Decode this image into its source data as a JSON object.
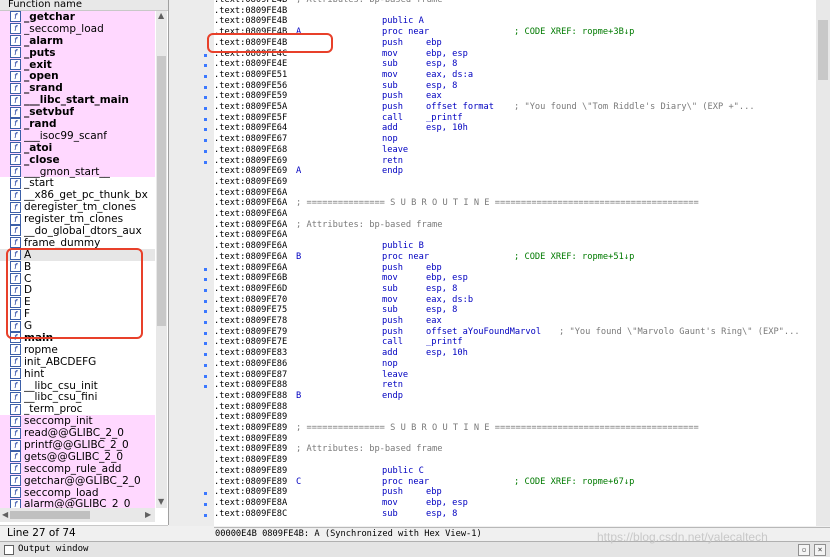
{
  "functions_panel": {
    "header": "Function name",
    "items": [
      {
        "label": "_getchar",
        "lib": true,
        "bold": true
      },
      {
        "label": "_seccomp_load",
        "lib": true,
        "bold": false
      },
      {
        "label": "_alarm",
        "lib": true,
        "bold": true
      },
      {
        "label": "_puts",
        "lib": true,
        "bold": true
      },
      {
        "label": "_exit",
        "lib": true,
        "bold": true
      },
      {
        "label": "_open",
        "lib": true,
        "bold": true
      },
      {
        "label": "_srand",
        "lib": true,
        "bold": true
      },
      {
        "label": "___libc_start_main",
        "lib": true,
        "bold": true
      },
      {
        "label": "_setvbuf",
        "lib": true,
        "bold": true
      },
      {
        "label": "_rand",
        "lib": true,
        "bold": true
      },
      {
        "label": "___isoc99_scanf",
        "lib": true,
        "bold": false
      },
      {
        "label": "_atoi",
        "lib": true,
        "bold": true
      },
      {
        "label": "_close",
        "lib": true,
        "bold": true
      },
      {
        "label": "___gmon_start__",
        "lib": true,
        "bold": false
      },
      {
        "label": "_start",
        "lib": false,
        "bold": false
      },
      {
        "label": "__x86_get_pc_thunk_bx",
        "lib": false,
        "bold": false
      },
      {
        "label": "deregister_tm_clones",
        "lib": false,
        "bold": false
      },
      {
        "label": "register_tm_clones",
        "lib": false,
        "bold": false
      },
      {
        "label": "__do_global_dtors_aux",
        "lib": false,
        "bold": false
      },
      {
        "label": "frame_dummy",
        "lib": false,
        "bold": false
      },
      {
        "label": "A",
        "lib": false,
        "bold": false,
        "selected": true
      },
      {
        "label": "B",
        "lib": false,
        "bold": false
      },
      {
        "label": "C",
        "lib": false,
        "bold": false
      },
      {
        "label": "D",
        "lib": false,
        "bold": false
      },
      {
        "label": "E",
        "lib": false,
        "bold": false
      },
      {
        "label": "F",
        "lib": false,
        "bold": false
      },
      {
        "label": "G",
        "lib": false,
        "bold": false
      },
      {
        "label": "main",
        "lib": false,
        "bold": true
      },
      {
        "label": "ropme",
        "lib": false,
        "bold": false
      },
      {
        "label": "init_ABCDEFG",
        "lib": false,
        "bold": false
      },
      {
        "label": "hint",
        "lib": false,
        "bold": false
      },
      {
        "label": "__libc_csu_init",
        "lib": false,
        "bold": false
      },
      {
        "label": "__libc_csu_fini",
        "lib": false,
        "bold": false
      },
      {
        "label": "_term_proc",
        "lib": false,
        "bold": false
      },
      {
        "label": "seccomp_init",
        "lib": true,
        "bold": false
      },
      {
        "label": "read@@GLIBC_2_0",
        "lib": true,
        "bold": false
      },
      {
        "label": "printf@@GLIBC_2_0",
        "lib": true,
        "bold": false
      },
      {
        "label": "gets@@GLIBC_2_0",
        "lib": true,
        "bold": false
      },
      {
        "label": "seccomp_rule_add",
        "lib": true,
        "bold": false
      },
      {
        "label": "getchar@@GLIBC_2_0",
        "lib": true,
        "bold": false
      },
      {
        "label": "seccomp_load",
        "lib": true,
        "bold": false
      },
      {
        "label": "alarm@@GLIBC_2_0",
        "lib": true,
        "bold": false
      }
    ],
    "status": "Line 27 of 74",
    "icon_glyph": "f"
  },
  "disassembly": {
    "lines": [
      {
        "addr": ".text:0809FE4B",
        "cm": "; Attributes: bp-based frame",
        "cmx": 82
      },
      {
        "addr": ".text:0809FE4B"
      },
      {
        "addr": ".text:0809FE4B",
        "mn": "public A"
      },
      {
        "addr": ".text:0809FE4B",
        "lbl": "A",
        "mn": "proc near",
        "xref": "; CODE XREF: ropme+3B↓p"
      },
      {
        "addr": ".text:0809FE4B",
        "mn": "push",
        "op": "ebp"
      },
      {
        "addr": ".text:0809FE4C",
        "mn": "mov",
        "op": "ebp, esp",
        "dot": true
      },
      {
        "addr": ".text:0809FE4E",
        "mn": "sub",
        "op": "esp, 8",
        "dot": true
      },
      {
        "addr": ".text:0809FE51",
        "mn": "mov",
        "op": "eax, ds:a",
        "dot": true
      },
      {
        "addr": ".text:0809FE56",
        "mn": "sub",
        "op": "esp, 8",
        "dot": true
      },
      {
        "addr": ".text:0809FE59",
        "mn": "push",
        "op": "eax",
        "dot": true
      },
      {
        "addr": ".text:0809FE5A",
        "mn": "push",
        "op": "offset format",
        "cm": "; \"You found \\\"Tom Riddle's Diary\\\" (EXP +\"...",
        "cmx": 300,
        "dot": true
      },
      {
        "addr": ".text:0809FE5F",
        "mn": "call",
        "op": "_printf",
        "dot": true
      },
      {
        "addr": ".text:0809FE64",
        "mn": "add",
        "op": "esp, 10h",
        "dot": true
      },
      {
        "addr": ".text:0809FE67",
        "mn": "nop",
        "dot": true
      },
      {
        "addr": ".text:0809FE68",
        "mn": "leave",
        "dot": true
      },
      {
        "addr": ".text:0809FE69",
        "mn": "retn",
        "dot": true
      },
      {
        "addr": ".text:0809FE69",
        "lbl": "A",
        "mn": "endp"
      },
      {
        "addr": ".text:0809FE69"
      },
      {
        "addr": ".text:0809FE6A"
      },
      {
        "addr": ".text:0809FE6A",
        "cm": "; =============== S U B R O U T I N E =======================================",
        "cmx": 82
      },
      {
        "addr": ".text:0809FE6A"
      },
      {
        "addr": ".text:0809FE6A",
        "cm": "; Attributes: bp-based frame",
        "cmx": 82
      },
      {
        "addr": ".text:0809FE6A"
      },
      {
        "addr": ".text:0809FE6A",
        "mn": "public B"
      },
      {
        "addr": ".text:0809FE6A",
        "lbl": "B",
        "mn": "proc near",
        "xref": "; CODE XREF: ropme+51↓p"
      },
      {
        "addr": ".text:0809FE6A",
        "mn": "push",
        "op": "ebp",
        "dot": true
      },
      {
        "addr": ".text:0809FE6B",
        "mn": "mov",
        "op": "ebp, esp",
        "dot": true
      },
      {
        "addr": ".text:0809FE6D",
        "mn": "sub",
        "op": "esp, 8",
        "dot": true
      },
      {
        "addr": ".text:0809FE70",
        "mn": "mov",
        "op": "eax, ds:b",
        "dot": true
      },
      {
        "addr": ".text:0809FE75",
        "mn": "sub",
        "op": "esp, 8",
        "dot": true
      },
      {
        "addr": ".text:0809FE78",
        "mn": "push",
        "op": "eax",
        "dot": true
      },
      {
        "addr": ".text:0809FE79",
        "mn": "push",
        "op": "offset aYouFoundMarvol",
        "cm": "; \"You found \\\"Marvolo Gaunt's Ring\\\" (EXP\"...",
        "cmx": 345,
        "dot": true
      },
      {
        "addr": ".text:0809FE7E",
        "mn": "call",
        "op": "_printf",
        "dot": true
      },
      {
        "addr": ".text:0809FE83",
        "mn": "add",
        "op": "esp, 10h",
        "dot": true
      },
      {
        "addr": ".text:0809FE86",
        "mn": "nop",
        "dot": true
      },
      {
        "addr": ".text:0809FE87",
        "mn": "leave",
        "dot": true
      },
      {
        "addr": ".text:0809FE88",
        "mn": "retn",
        "dot": true
      },
      {
        "addr": ".text:0809FE88",
        "lbl": "B",
        "mn": "endp"
      },
      {
        "addr": ".text:0809FE88"
      },
      {
        "addr": ".text:0809FE89"
      },
      {
        "addr": ".text:0809FE89",
        "cm": "; =============== S U B R O U T I N E =======================================",
        "cmx": 82
      },
      {
        "addr": ".text:0809FE89"
      },
      {
        "addr": ".text:0809FE89",
        "cm": "; Attributes: bp-based frame",
        "cmx": 82
      },
      {
        "addr": ".text:0809FE89"
      },
      {
        "addr": ".text:0809FE89",
        "mn": "public C"
      },
      {
        "addr": ".text:0809FE89",
        "lbl": "C",
        "mn": "proc near",
        "xref": "; CODE XREF: ropme+67↓p"
      },
      {
        "addr": ".text:0809FE89",
        "mn": "push",
        "op": "ebp",
        "dot": true
      },
      {
        "addr": ".text:0809FE8A",
        "mn": "mov",
        "op": "ebp, esp",
        "dot": true
      },
      {
        "addr": ".text:0809FE8C",
        "mn": "sub",
        "op": "esp, 8",
        "dot": true
      }
    ],
    "status": "00000E4B 0809FE4B: A (Synchronized with Hex View-1)"
  },
  "output_window": {
    "label": "Output window"
  },
  "watermark": "https://blog.csdn.net/yalecaltech",
  "colors": {
    "annotation_box": "#e8402a",
    "library_function_bg": "#ffd8ff"
  }
}
